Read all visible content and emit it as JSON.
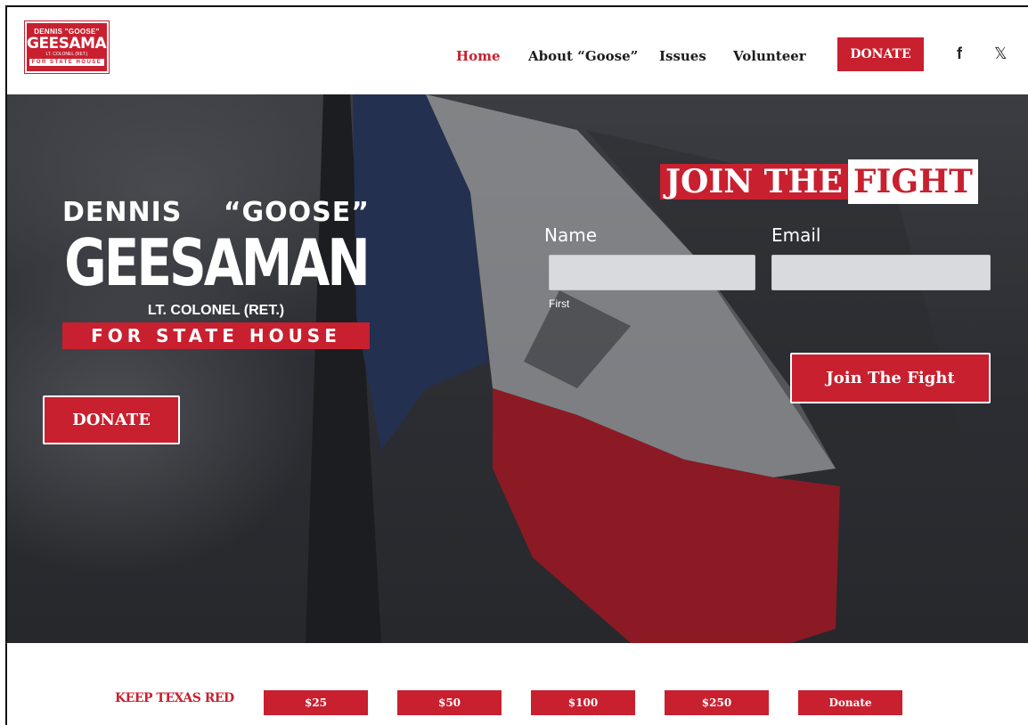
{
  "header": {
    "logo": {
      "line1": "DENNIS \"GOOSE\"",
      "line2": "GEESAMAN",
      "line3": "LT. COLONEL (RET.)",
      "line4": "FOR STATE HOUSE"
    },
    "nav": [
      {
        "label": "Home",
        "active": true
      },
      {
        "label": "About “Goose”",
        "active": false
      },
      {
        "label": "Issues",
        "active": false
      },
      {
        "label": "Volunteer",
        "active": false
      }
    ],
    "donate_label": "DONATE",
    "social": {
      "facebook": "f",
      "x": "𝕏"
    }
  },
  "hero": {
    "first_name": "DENNIS",
    "nickname": "“GOOSE”",
    "last_name": "GEESAMAN",
    "rank": "LT. COLONEL (RET.)",
    "office": "FOR STATE HOUSE",
    "donate_label": "DONATE"
  },
  "join": {
    "title_a": "JOIN THE",
    "title_b": "FIGHT",
    "name_label": "Name",
    "name_sublabel": "First",
    "name_value": "",
    "email_label": "Email",
    "email_value": "",
    "submit_label": "Join The Fight"
  },
  "strip": {
    "tagline": "KEEP TEXAS RED",
    "amounts": [
      "$25",
      "$50",
      "$100",
      "$250",
      "Donate"
    ]
  },
  "colors": {
    "brand_red": "#c8202f",
    "flag_blue": "#23304f",
    "hero_dark": "#2c2e33"
  }
}
